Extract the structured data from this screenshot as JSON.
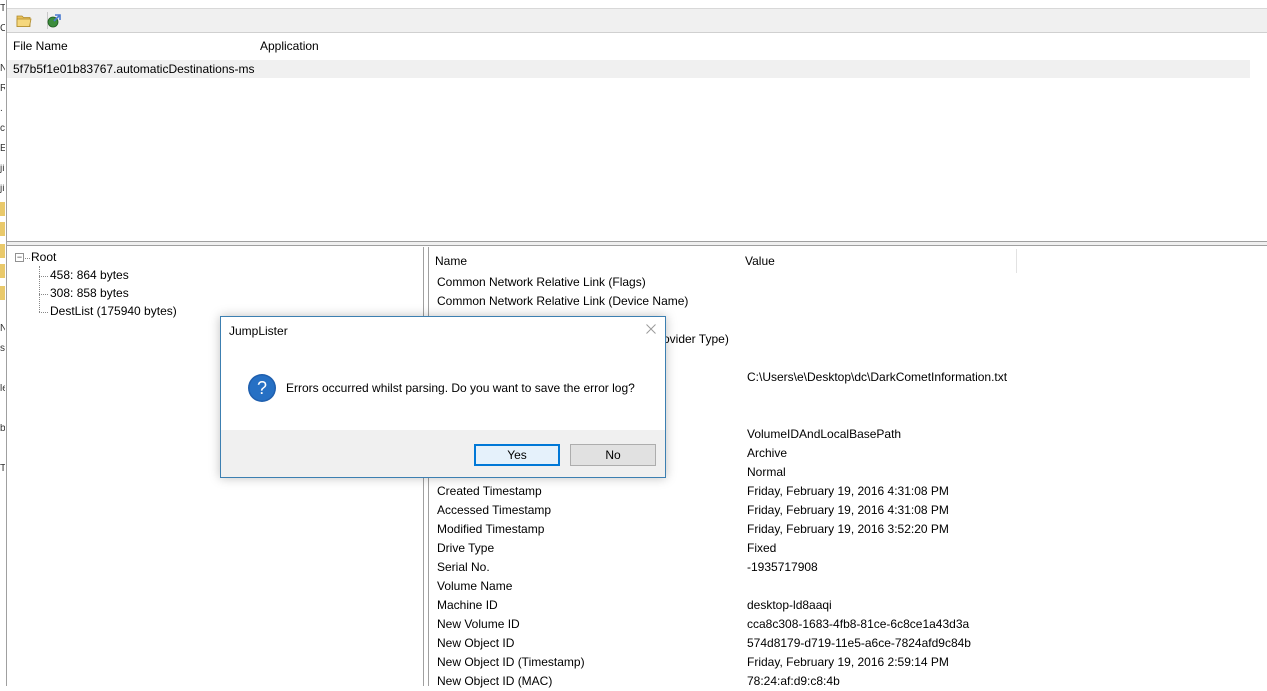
{
  "toolbar": {
    "open_icon": "folder-open-icon",
    "export_icon": "export-icon"
  },
  "file_list": {
    "columns": [
      "File Name",
      "Application"
    ],
    "rows": [
      {
        "file_name": "5f7b5f1e01b83767.automaticDestinations-ms",
        "application": ""
      }
    ]
  },
  "tree": {
    "root_label": "Root",
    "children": [
      "458: 864 bytes",
      "308: 858 bytes",
      "DestList (175940 bytes)"
    ]
  },
  "properties": {
    "columns": [
      "Name",
      "Value"
    ],
    "rows": [
      {
        "name": "Common Network Relative Link (Flags)",
        "value": ""
      },
      {
        "name": "Common Network Relative Link (Device Name)",
        "value": ""
      },
      {
        "name": "",
        "value": ""
      },
      {
        "name": "rovider Type)",
        "value": ""
      },
      {
        "name": "",
        "value": ""
      },
      {
        "name": "",
        "value": "C:\\Users\\e\\Desktop\\dc\\DarkCometInformation.txt"
      },
      {
        "name": "",
        "value": ""
      },
      {
        "name": "",
        "value": ""
      },
      {
        "name": "",
        "value": "VolumeIDAndLocalBasePath"
      },
      {
        "name": "",
        "value": "Archive"
      },
      {
        "name": "",
        "value": "Normal"
      },
      {
        "name": "Created Timestamp",
        "value": "Friday, February 19, 2016 4:31:08 PM"
      },
      {
        "name": "Accessed Timestamp",
        "value": "Friday, February 19, 2016 4:31:08 PM"
      },
      {
        "name": "Modified Timestamp",
        "value": "Friday, February 19, 2016 3:52:20 PM"
      },
      {
        "name": "Drive Type",
        "value": "Fixed"
      },
      {
        "name": "Serial No.",
        "value": "-1935717908"
      },
      {
        "name": "Volume Name",
        "value": ""
      },
      {
        "name": "Machine ID",
        "value": "desktop-ld8aaqi"
      },
      {
        "name": "New Volume ID",
        "value": "cca8c308-1683-4fb8-81ce-6c8ce1a43d3a"
      },
      {
        "name": "New Object ID",
        "value": "574d8179-d719-11e5-a6ce-7824afd9c84b"
      },
      {
        "name": "New Object ID (Timestamp)",
        "value": "Friday, February 19, 2016 2:59:14 PM"
      },
      {
        "name": "New Object ID (MAC)",
        "value": "78:24:af:d9:c8:4b"
      }
    ]
  },
  "dialog": {
    "title": "JumpLister",
    "message": "Errors occurred whilst parsing. Do you want to save the error log?",
    "icon": "question-icon",
    "yes_label": "Yes",
    "no_label": "No"
  },
  "left_strip": {
    "chars": [
      "T",
      "C",
      "N",
      "R",
      ".",
      "c",
      "E",
      "ji",
      "ji",
      "N",
      "s",
      "le",
      "b",
      "T"
    ]
  }
}
